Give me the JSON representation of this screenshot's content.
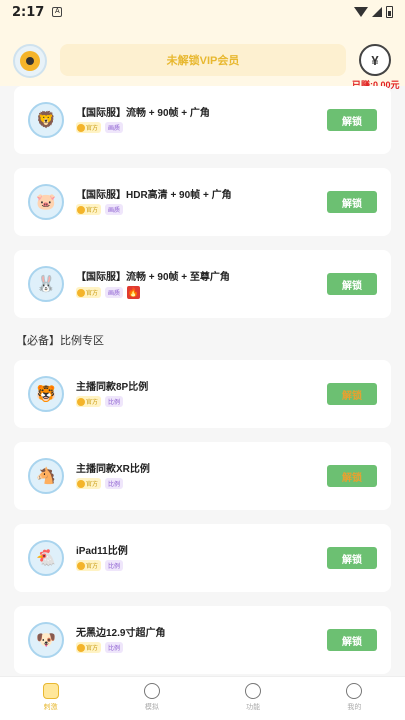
{
  "status": {
    "time": "2:17",
    "sim": "A"
  },
  "header": {
    "vip_text": "未解锁VIP会员",
    "balance": "已赚:0.00元",
    "wallet_symbol": "¥"
  },
  "cards": [
    {
      "title": "【国际服】流畅 + 90帧 + 广角",
      "tags": [
        "官方",
        "画质"
      ],
      "button": "解锁",
      "icon": "lion-face-icon"
    },
    {
      "title": "【国际服】HDR高清 + 90帧 + 广角",
      "tags": [
        "官方",
        "画质"
      ],
      "button": "解锁",
      "icon": "pig-face-icon"
    },
    {
      "title": "【国际服】流畅 + 90帧 + 至尊广角",
      "tags": [
        "官方",
        "画质"
      ],
      "button": "解锁",
      "icon": "rabbit-face-icon",
      "hot": "🔥"
    }
  ],
  "section": {
    "title": "【必备】比例专区"
  },
  "ratio_cards": [
    {
      "title": "主播同款8P比例",
      "tags": [
        "官方",
        "比例"
      ],
      "button": "解锁"
    },
    {
      "title": "主播同款XR比例",
      "tags": [
        "官方",
        "比例"
      ],
      "button": "解锁"
    },
    {
      "title": "iPad11比例",
      "tags": [
        "官方",
        "比例"
      ],
      "button": "解锁"
    },
    {
      "title": "无黑边12.9寸超广角",
      "tags": [
        "官方",
        "比例"
      ],
      "button": "解锁"
    }
  ],
  "tabs": [
    {
      "label": "刺激",
      "active": true
    },
    {
      "label": "模拟"
    },
    {
      "label": "功能"
    },
    {
      "label": "我的"
    }
  ]
}
